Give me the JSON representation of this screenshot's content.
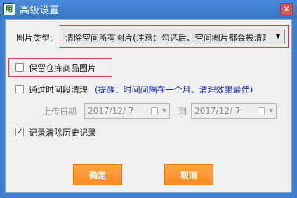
{
  "window": {
    "title": "高级设置",
    "app_icon_text": "用",
    "close_glyph": "✕"
  },
  "image_type": {
    "label": "图片类型:",
    "selected": "清除空间所有图片(注意：勾选后、空间图片都会被清理"
  },
  "options": {
    "keep_warehouse": {
      "label": "保留仓库商品图片",
      "checked": false
    },
    "clear_by_period": {
      "label": "通过时间段清理",
      "hint": "(提醒：时间间隔在一个月、清理效果最佳)",
      "checked": false
    },
    "record_history": {
      "label": "记录清除历史记录",
      "checked": true
    }
  },
  "upload_date": {
    "label": "上传日期",
    "from": "2017/12/  7",
    "to_label": "到",
    "to": "2017/12/  7"
  },
  "buttons": {
    "confirm": "确定",
    "cancel": "取消"
  },
  "colors": {
    "title_bar": "#3f7fcf",
    "button": "#ff8a1f",
    "hint_text": "#1c2fb8",
    "highlight": "#e53935"
  }
}
